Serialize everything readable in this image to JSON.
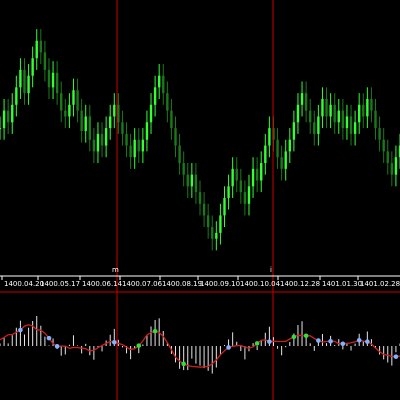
{
  "colors": {
    "background": "#000000",
    "frame": "#ffffff",
    "candle_up": "#33ff33",
    "candle_down": "#1a7a1a",
    "period_separator": "#cc0000",
    "axis_text": "#ffffff",
    "histogram": "#e6e6e6",
    "signal_line": "#cc2020",
    "dot_blue": "#7fb2ff",
    "dot_green": "#33dd33",
    "divider": "#cc0000"
  },
  "x_axis": {
    "dates": [
      "1400.04.20",
      "1400.05.17",
      "1400.06.14",
      "1400.07.06",
      "1400.08.19",
      "1400.09.10",
      "1400.10.04",
      "1400.12.28",
      "1401.01.30",
      "1401.02.28"
    ]
  },
  "markers": {
    "left": "m",
    "right": "i"
  },
  "chart_data": {
    "type": "candlestick",
    "panels": [
      "price",
      "oscillator"
    ],
    "price_series": [
      66,
      72,
      68,
      74,
      80,
      86,
      78,
      84,
      90,
      96,
      92,
      86,
      80,
      85,
      78,
      72,
      70,
      74,
      79,
      72,
      65,
      70,
      62,
      58,
      64,
      60,
      66,
      70,
      74,
      68,
      64,
      60,
      56,
      62,
      58,
      62,
      68,
      74,
      80,
      84,
      78,
      72,
      66,
      60,
      54,
      50,
      46,
      50,
      44,
      40,
      36,
      32,
      28,
      30,
      36,
      42,
      46,
      52,
      48,
      44,
      40,
      46,
      52,
      48,
      54,
      60,
      66,
      62,
      56,
      52,
      58,
      62,
      68,
      74,
      78,
      72,
      68,
      64,
      70,
      76,
      70,
      74,
      68,
      72,
      66,
      70,
      64,
      68,
      74,
      70,
      76,
      72,
      66,
      62,
      58,
      54,
      50,
      56,
      60
    ],
    "oscillator": {
      "dots": [
        {
          "idx": 5,
          "color": "blue"
        },
        {
          "idx": 12,
          "color": "blue"
        },
        {
          "idx": 14,
          "color": "blue"
        },
        {
          "idx": 28,
          "color": "blue"
        },
        {
          "idx": 34,
          "color": "green"
        },
        {
          "idx": 38,
          "color": "green"
        },
        {
          "idx": 45,
          "color": "green"
        },
        {
          "idx": 56,
          "color": "blue"
        },
        {
          "idx": 63,
          "color": "green"
        },
        {
          "idx": 66,
          "color": "blue"
        },
        {
          "idx": 72,
          "color": "green"
        },
        {
          "idx": 75,
          "color": "green"
        },
        {
          "idx": 78,
          "color": "blue"
        },
        {
          "idx": 81,
          "color": "blue"
        },
        {
          "idx": 84,
          "color": "blue"
        },
        {
          "idx": 88,
          "color": "blue"
        },
        {
          "idx": 90,
          "color": "blue"
        },
        {
          "idx": 97,
          "color": "blue"
        }
      ]
    }
  }
}
